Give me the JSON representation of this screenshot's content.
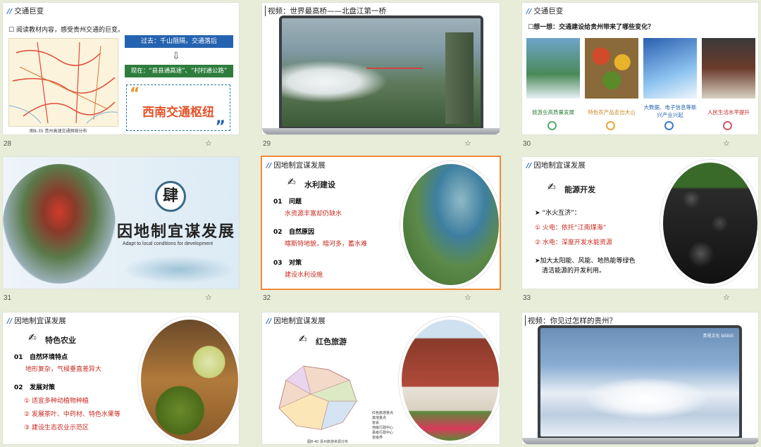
{
  "slides": [
    {
      "num": "28",
      "title": "交通巨变",
      "bullet": "阅读教材内容，感受贵州交通的巨变。",
      "past": "过去：千山阻隔，交通落后",
      "now": "现在：“县县通高速”、“村村通公路”",
      "hub": "西南交通枢纽",
      "map_caption": "图8-35  贵州高速交通网络分布"
    },
    {
      "num": "29",
      "title": "视频：世界最高桥——北盘江第一桥"
    },
    {
      "num": "30",
      "title": "交通巨变",
      "question": "想一想：交通建设给贵州带来了哪些变化？",
      "items": [
        "旅游业高质量发展",
        "特色农产品走出大山",
        "大数据、电子信息等新兴产业兴起",
        "人民生活水平提升"
      ]
    },
    {
      "num": "31",
      "seal": "肆",
      "main": "因地制宜谋发展",
      "sub": "Adapt to local conditions for development"
    },
    {
      "num": "32",
      "title": "因地制宜谋发展",
      "heading": "水利建设",
      "points": [
        {
          "n": "01",
          "label": "问题",
          "detail": "水资源丰富却仍缺水"
        },
        {
          "n": "02",
          "label": "自然原因",
          "detail": "喀斯特地貌，暗河多，蓄水难"
        },
        {
          "n": "03",
          "label": "对策",
          "detail": "建设水利设施"
        }
      ]
    },
    {
      "num": "33",
      "title": "因地制宜谋发展",
      "heading": "能源开发",
      "line1": "“水火互济”：",
      "line2": "① 火电：依托“江南煤海”",
      "line3": "② 水电：深度开发水能资源",
      "line4a": "加大太阳能、风能、地热能等绿色",
      "line4b": "清洁能源的开发利用。"
    },
    {
      "num": "34",
      "title": "因地制宜谋发展",
      "heading": "特色农业",
      "p1n": "01",
      "p1": "自然环境特点",
      "p1d": "地形复杂，气候垂直差异大",
      "p2n": "02",
      "p2": "发展对策",
      "items": [
        "① 适宜多种动植物种植",
        "② 发展茶叶、中药材、特色水果等",
        "③ 建设生态农业示范区"
      ]
    },
    {
      "num": "35",
      "title": "因地制宜谋发展",
      "heading": "红色旅游",
      "map_caption": "图8-40  贵州旅游资源分布",
      "legend": [
        "红色旅游景点",
        "其他景点",
        "省会",
        "地级行政中心",
        "县级行政中心",
        "省级界"
      ]
    },
    {
      "num": "36",
      "title": "视频：你见过怎样的贵州？",
      "watermark": "贵视文化 bilibili"
    }
  ],
  "colors": {
    "accent": "#2563b0",
    "red": "#c8291f",
    "selection": "#f2893a",
    "bg": "#e8edd9"
  }
}
